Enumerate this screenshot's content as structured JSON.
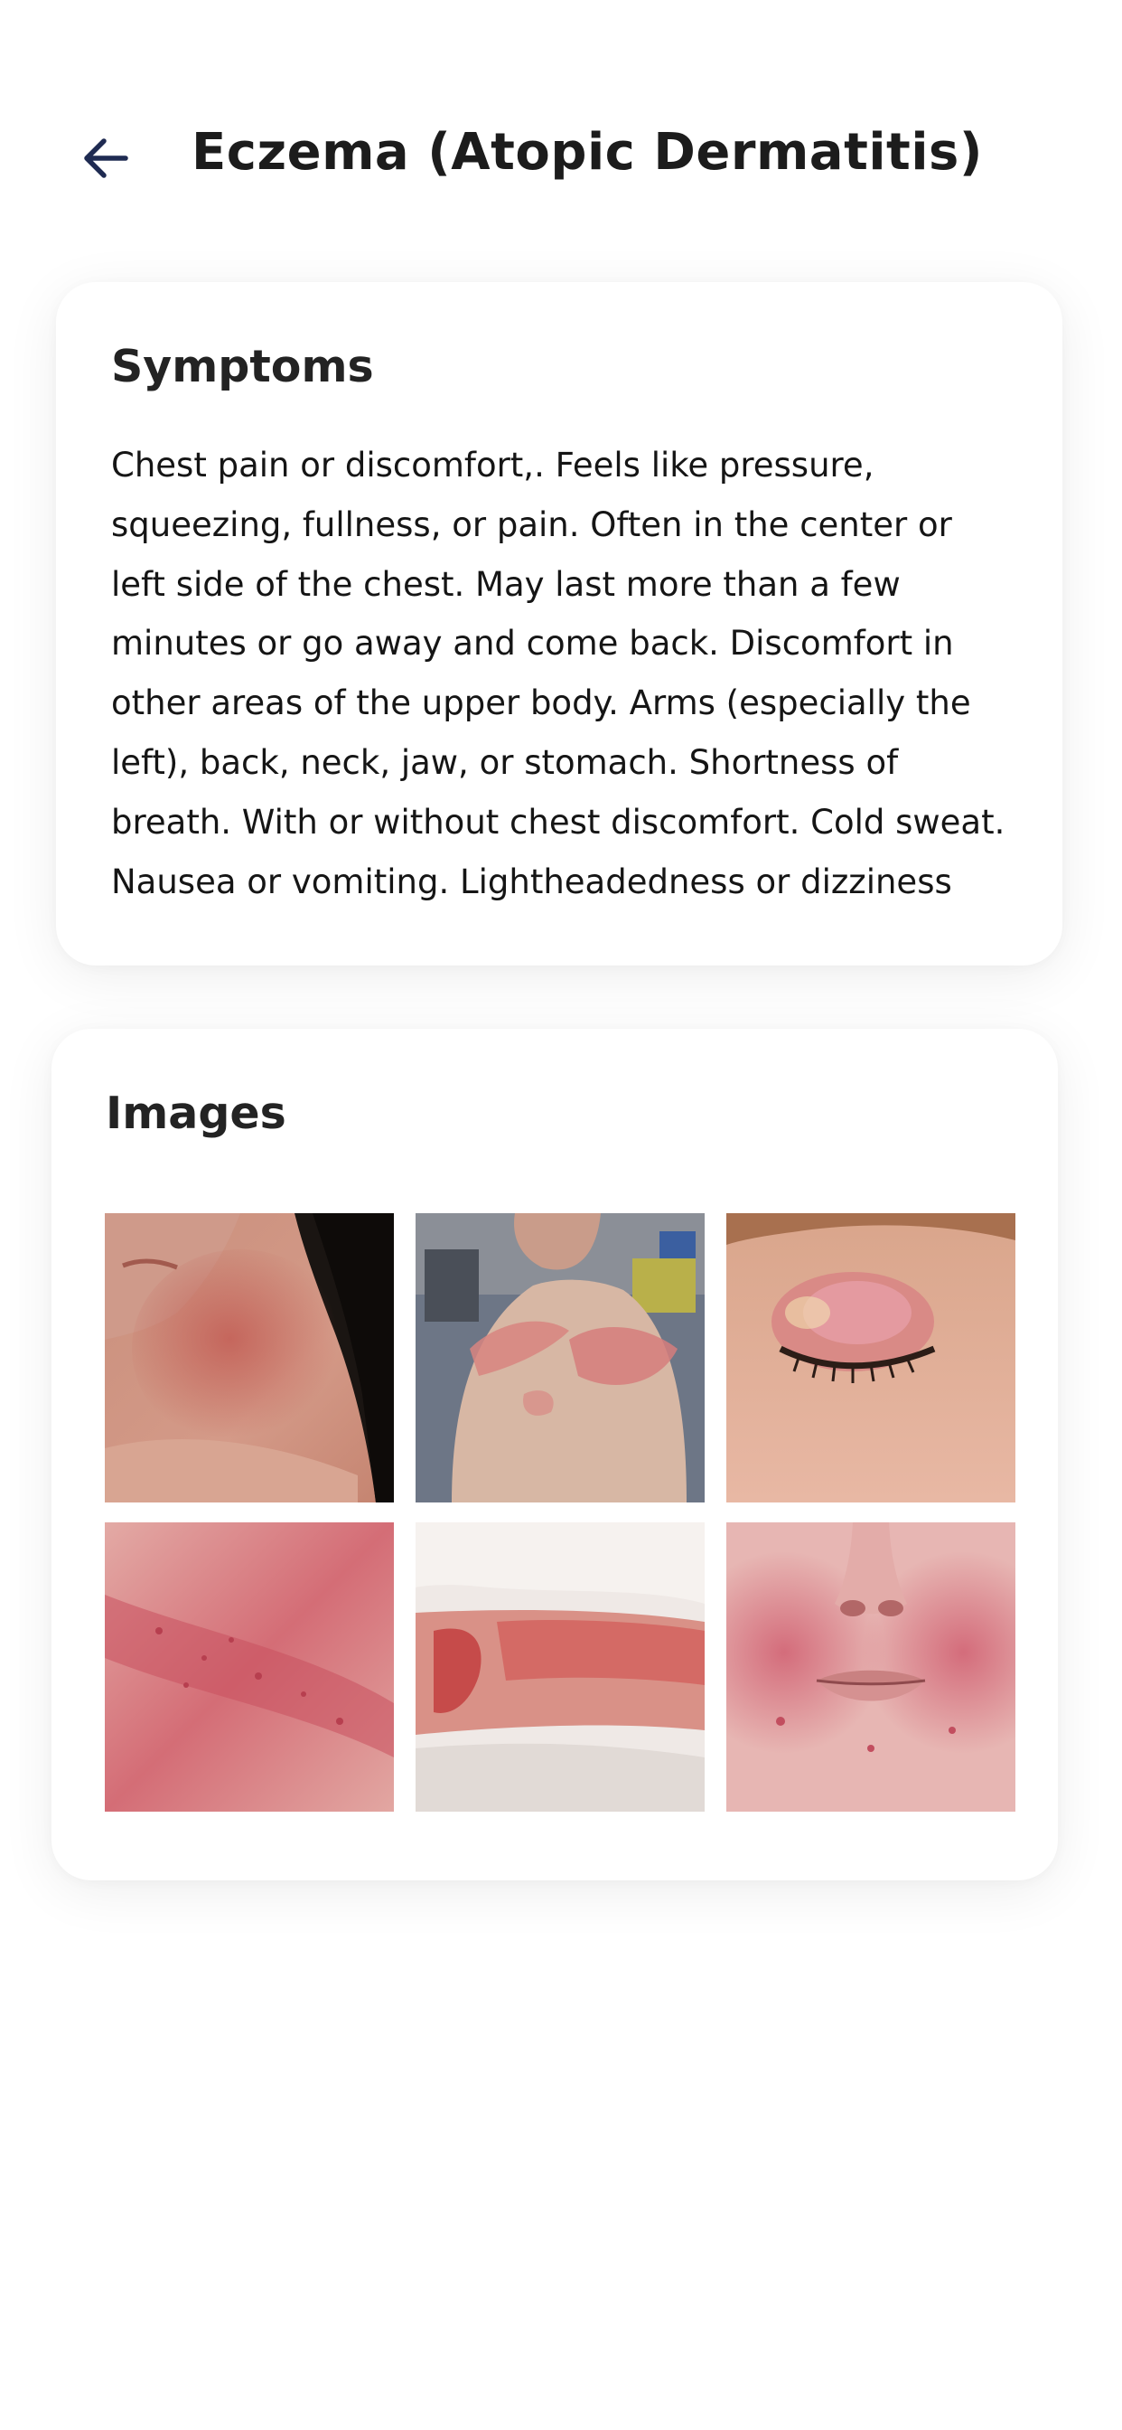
{
  "header": {
    "back_icon": "arrow-left-icon",
    "title": "Eczema (Atopic Dermatitis)"
  },
  "symptoms": {
    "heading": "Symptoms",
    "text": "Chest pain or discomfort,. Feels like pressure, squeezing, fullness, or pain. Often in the center or left side of the chest. May last more than a few minutes or go away and come back. Discomfort in other areas of the upper body. Arms (especially the left), back, neck, jaw, or stomach. Shortness of breath. With or without chest discomfort. Cold sweat. Nausea or vomiting. Lightheadedness or dizziness"
  },
  "images": {
    "heading": "Images",
    "items": [
      {
        "subject": "neck-rash"
      },
      {
        "subject": "back-rash"
      },
      {
        "subject": "eyelid-rash"
      },
      {
        "subject": "skin-closeup-rash"
      },
      {
        "subject": "arm-rash"
      },
      {
        "subject": "face-rash"
      }
    ]
  },
  "colors": {
    "icon": "#1f2b52",
    "title": "#1c1c1c",
    "background": "#ffffff",
    "card": "#ffffff"
  }
}
